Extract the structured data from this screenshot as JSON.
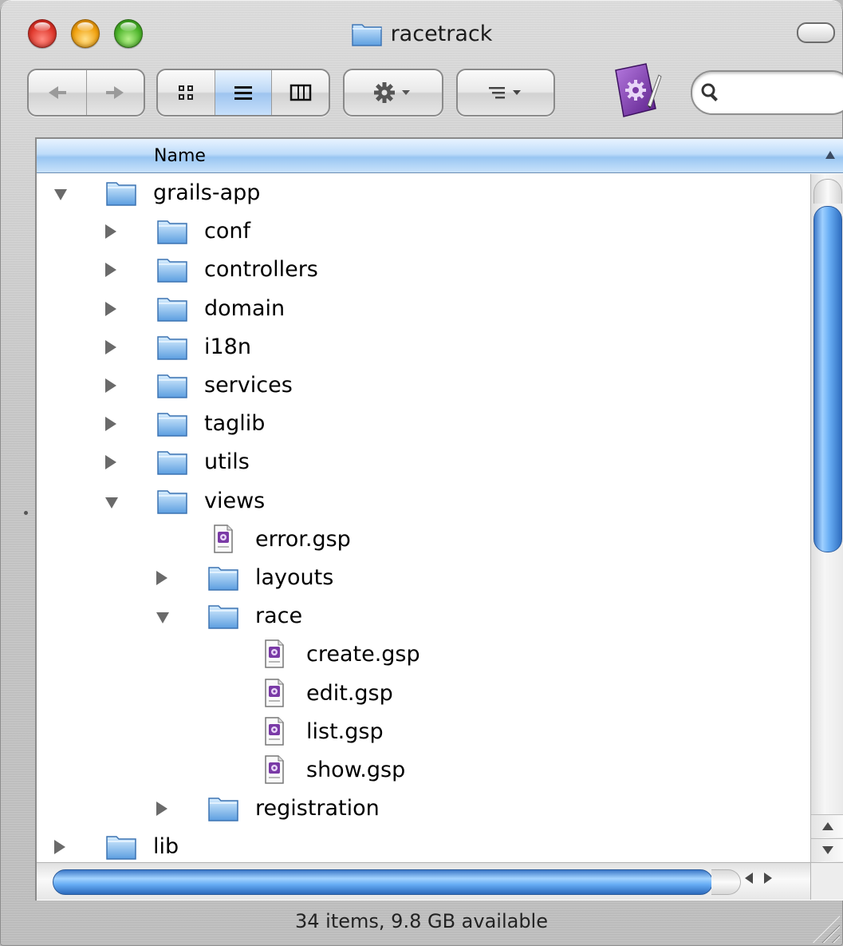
{
  "window": {
    "title": "racetrack"
  },
  "toolbar": {
    "back_icon": "back-arrow-icon",
    "forward_icon": "forward-arrow-icon",
    "views": [
      "icon-view-icon",
      "list-view-icon",
      "column-view-icon"
    ],
    "active_view": "list-view-icon",
    "action_icon": "gear-icon",
    "arrange_icon": "arrange-icon",
    "app_icon": "gsp-editor-app-icon",
    "search": {
      "value": "",
      "placeholder": ""
    }
  },
  "list": {
    "column_header": "Name",
    "sort_direction": "ascending",
    "rows": [
      {
        "label": "grails-app",
        "kind": "folder",
        "depth": 0,
        "expanded": true
      },
      {
        "label": "conf",
        "kind": "folder",
        "depth": 1,
        "expanded": false
      },
      {
        "label": "controllers",
        "kind": "folder",
        "depth": 1,
        "expanded": false
      },
      {
        "label": "domain",
        "kind": "folder",
        "depth": 1,
        "expanded": false
      },
      {
        "label": "i18n",
        "kind": "folder",
        "depth": 1,
        "expanded": false
      },
      {
        "label": "services",
        "kind": "folder",
        "depth": 1,
        "expanded": false
      },
      {
        "label": "taglib",
        "kind": "folder",
        "depth": 1,
        "expanded": false
      },
      {
        "label": "utils",
        "kind": "folder",
        "depth": 1,
        "expanded": false
      },
      {
        "label": "views",
        "kind": "folder",
        "depth": 1,
        "expanded": true
      },
      {
        "label": "error.gsp",
        "kind": "file",
        "depth": 2
      },
      {
        "label": "layouts",
        "kind": "folder",
        "depth": 2,
        "expanded": false
      },
      {
        "label": "race",
        "kind": "folder",
        "depth": 2,
        "expanded": true
      },
      {
        "label": "create.gsp",
        "kind": "file",
        "depth": 3
      },
      {
        "label": "edit.gsp",
        "kind": "file",
        "depth": 3
      },
      {
        "label": "list.gsp",
        "kind": "file",
        "depth": 3
      },
      {
        "label": "show.gsp",
        "kind": "file",
        "depth": 3
      },
      {
        "label": "registration",
        "kind": "folder",
        "depth": 2,
        "expanded": false
      },
      {
        "label": "lib",
        "kind": "folder",
        "depth": 0,
        "expanded": false
      }
    ]
  },
  "status_bar": {
    "text": "34 items, 9.8 GB available"
  },
  "colors": {
    "selection_blue": "#99c6f2",
    "scroll_thumb": "#66acf4",
    "gsp_purple": "#7a3aa6"
  }
}
